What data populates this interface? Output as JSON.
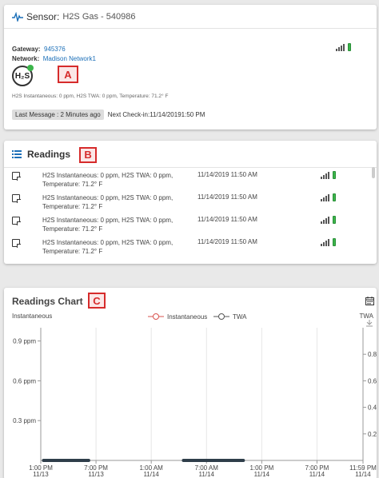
{
  "sensor": {
    "title_prefix": "Sensor:",
    "title_name": "H2S Gas - 540986",
    "gateway_label": "Gateway:",
    "gateway_value": "945376",
    "network_label": "Network:",
    "network_value": "Madison Network1",
    "icon_text": "H₂S",
    "annotation": "A",
    "reading_line": "H2S Instantaneous: 0 ppm, H2S TWA: 0 ppm, Temperature: 71.2° F",
    "last_message": "Last Message : 2 Minutes ago",
    "next_checkin": "Next Check-in:11/14/20191:50 PM",
    "battery_color": "#3bb54a"
  },
  "readings": {
    "title": "Readings",
    "annotation": "B",
    "rows": [
      {
        "text": "H2S Instantaneous: 0 ppm, H2S TWA: 0 ppm, Temperature: 71.2° F",
        "date": "11/14/2019 11:50 AM"
      },
      {
        "text": "H2S Instantaneous: 0 ppm, H2S TWA: 0 ppm, Temperature: 71.2° F",
        "date": "11/14/2019 11:50 AM"
      },
      {
        "text": "H2S Instantaneous: 0 ppm, H2S TWA: 0 ppm, Temperature: 71.2° F",
        "date": "11/14/2019 11:50 AM"
      },
      {
        "text": "H2S Instantaneous: 0 ppm, H2S TWA: 0 ppm, Temperature: 71.2° F",
        "date": "11/14/2019 11:50 AM"
      }
    ]
  },
  "chart": {
    "title": "Readings Chart",
    "annotation": "C",
    "accent_instantaneous": "#d9534f",
    "accent_twa": "#555555"
  },
  "chart_data": {
    "type": "line",
    "title": "Readings Chart",
    "ylabel_left": "Instantaneous",
    "ylabel_right": "TWA",
    "legend": [
      "Instantaneous",
      "TWA"
    ],
    "legend_position": "top-center",
    "y_left_ticks": [
      "0.3 ppm",
      "0.6 ppm",
      "0.9 ppm"
    ],
    "y_left_values": [
      0.3,
      0.6,
      0.9
    ],
    "y_left_range": [
      0,
      1.0
    ],
    "y_right_ticks": [
      "0.2",
      "0.4",
      "0.6",
      "0.8"
    ],
    "y_right_values": [
      0.2,
      0.4,
      0.6,
      0.8
    ],
    "y_right_range": [
      0,
      1.0
    ],
    "x_ticks": [
      {
        "time": "1:00 PM",
        "date": "11/13"
      },
      {
        "time": "7:00 PM",
        "date": "11/13"
      },
      {
        "time": "1:00 AM",
        "date": "11/14"
      },
      {
        "time": "7:00 AM",
        "date": "11/14"
      },
      {
        "time": "1:00 PM",
        "date": "11/14"
      },
      {
        "time": "7:00 PM",
        "date": "11/14"
      },
      {
        "time": "11:59 PM",
        "date": "11/14"
      }
    ],
    "x_range_hours": [
      0,
      35
    ],
    "x_tick_hours": [
      0,
      6,
      12,
      18,
      24,
      30,
      35
    ],
    "grid": "vertical",
    "series": [
      {
        "name": "Instantaneous",
        "segments": [
          [
            0.3,
            5.2
          ],
          [
            15.5,
            22.0
          ]
        ],
        "value": 0
      },
      {
        "name": "TWA",
        "segments": [
          [
            0.3,
            5.2
          ],
          [
            15.5,
            22.0
          ]
        ],
        "value": 0
      }
    ]
  }
}
